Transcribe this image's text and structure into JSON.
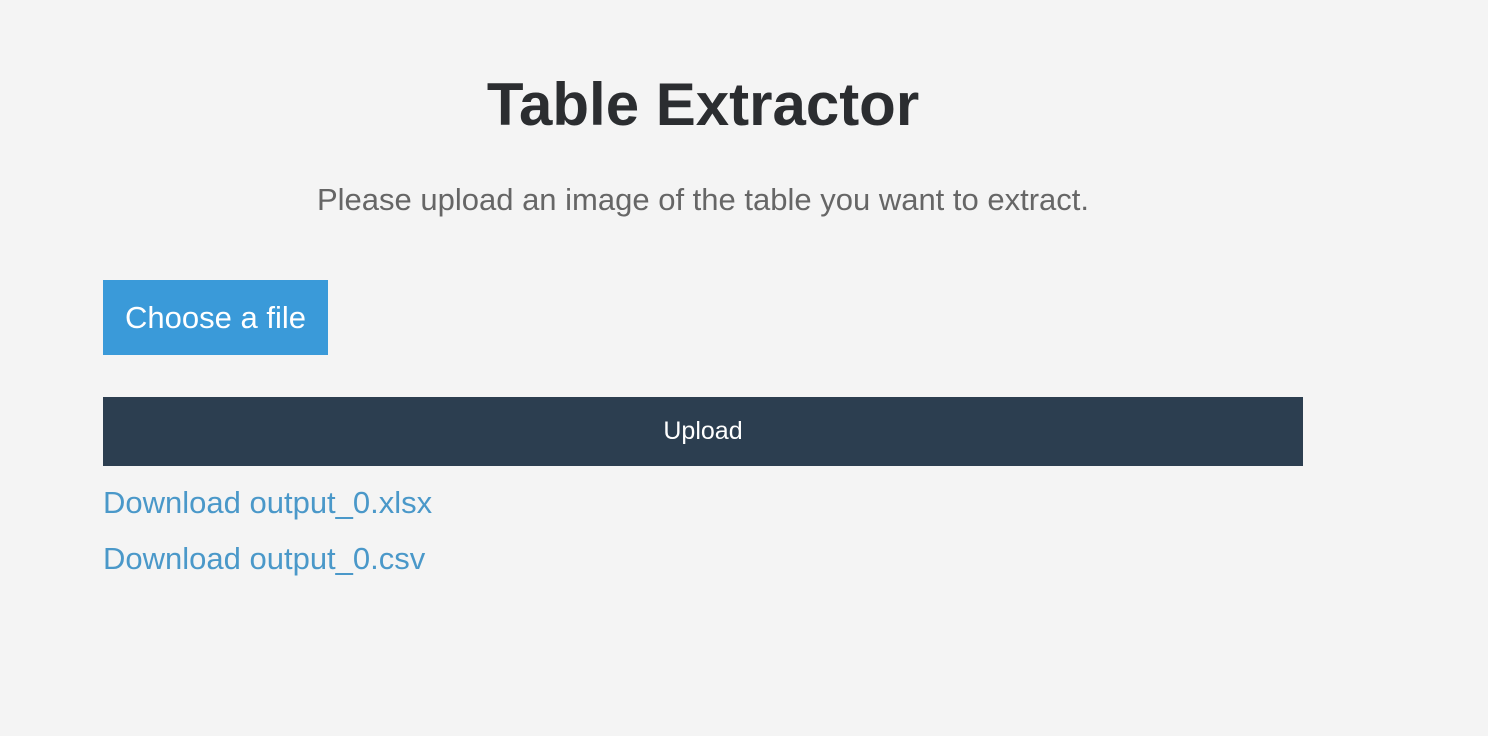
{
  "page": {
    "title": "Table Extractor",
    "subtitle": "Please upload an image of the table you want to extract."
  },
  "upload_form": {
    "choose_file_label": "Choose a file",
    "upload_label": "Upload"
  },
  "downloads": {
    "xlsx_label": "Download output_0.xlsx",
    "csv_label": "Download output_0.csv"
  },
  "colors": {
    "background": "#f4f4f4",
    "choose_button": "#3a9ad9",
    "upload_button": "#2c3e50",
    "link": "#4a98c9"
  }
}
